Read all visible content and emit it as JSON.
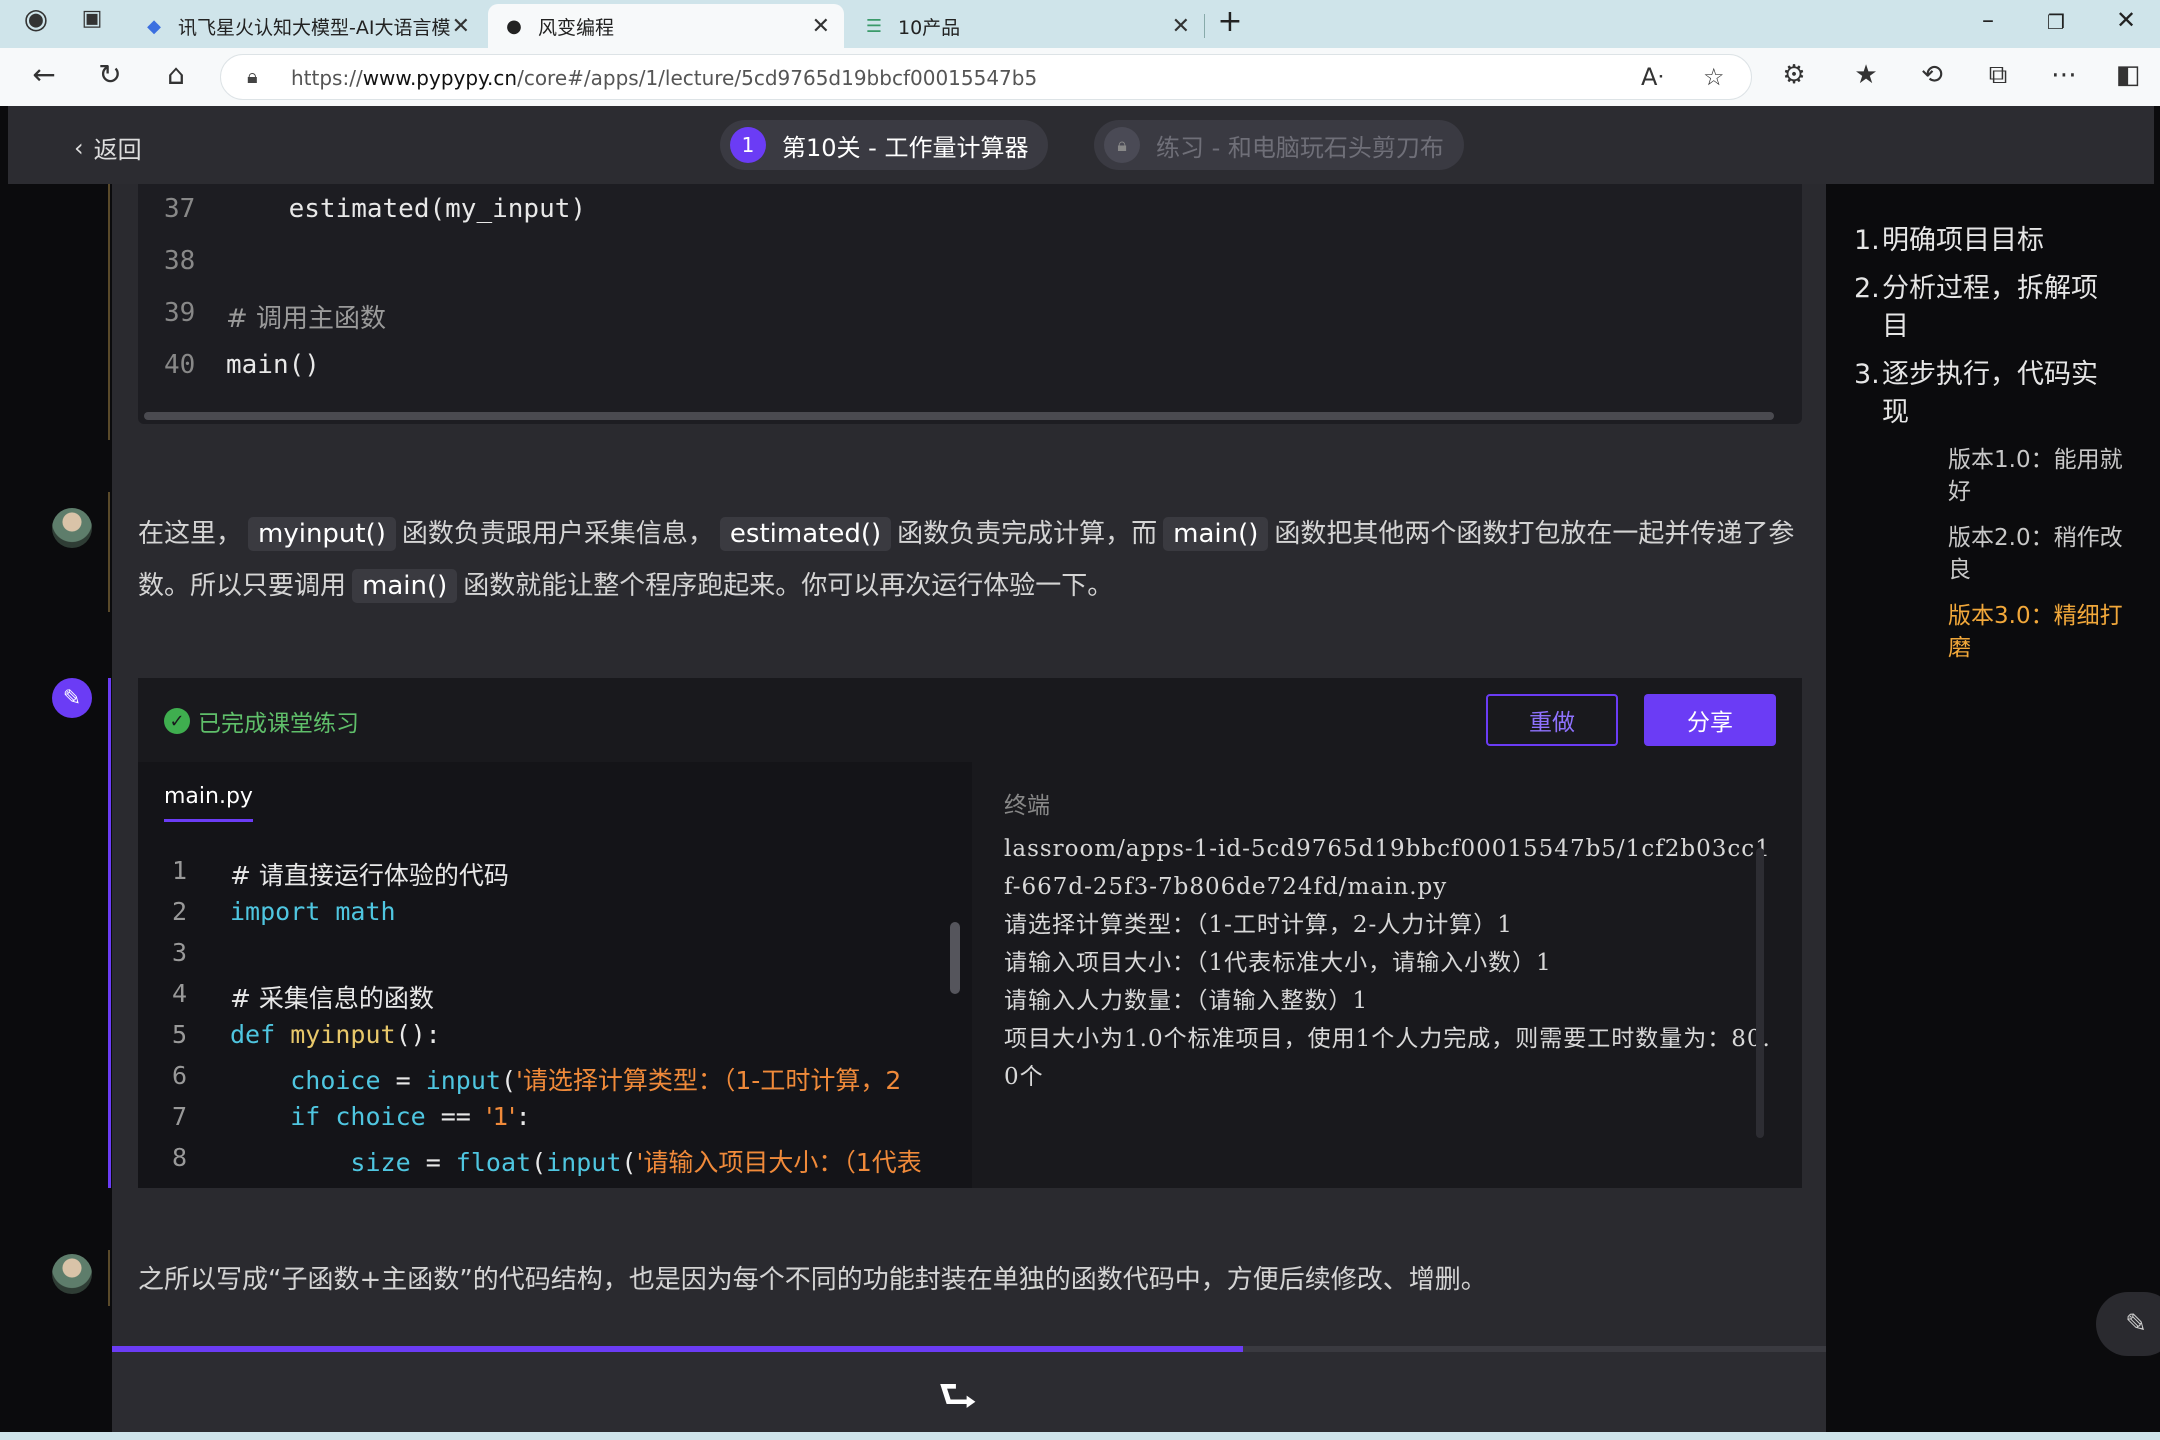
{
  "browser": {
    "tabs": [
      {
        "title": "讯飞星火认知大模型-AI大语言模",
        "icon": "spark-icon"
      },
      {
        "title": "风变编程",
        "icon": "panda-icon"
      },
      {
        "title": "10产品",
        "icon": "doc-icon"
      }
    ],
    "url_prefix": "https://",
    "url_domain": "www.pypypy.cn",
    "url_path": "/core#/apps/1/lecture/5cd9765d19bbcf00015547b5"
  },
  "header": {
    "back_label": "返回",
    "level_number": "1",
    "level_title": "第10关 - 工作量计算器",
    "locked_title": "练习 - 和电脑玩石头剪刀布"
  },
  "code_top": {
    "lines": [
      {
        "n": "37",
        "text": "    estimated(my_input)"
      },
      {
        "n": "38",
        "text": ""
      },
      {
        "n": "39",
        "text": "# 调用主函数"
      },
      {
        "n": "40",
        "text": "main()"
      }
    ]
  },
  "para1": {
    "t1": "在这里，",
    "c1": "myinput()",
    "t2": "函数负责跟用户采集信息，",
    "c2": "estimated()",
    "t3": "函数负责完成计算，而",
    "c3": "main()",
    "t4": "函数把其他两个函数打包放在一起并传递了参",
    "t5": "数。所以只要调用",
    "c4": "main()",
    "t6": "函数就能让整个程序跑起来。你可以再次运行体验一下。"
  },
  "exercise": {
    "status": "已完成课堂练习",
    "redo_label": "重做",
    "share_label": "分享",
    "file_tab": "main.py",
    "terminal_label": "终端",
    "terminal_output": "lassroom/apps-1-id-5cd9765d19bbcf00015547b5/1cf2b03cc1f-667d-25f3-7b806de724fd/main.py\n请选择计算类型：（1-工时计算，2-人力计算）1\n请输入项目大小：（1代表标准大小，请输入小数）1\n请输入人力数量：（请输入整数）1\n项目大小为1.0个标准项目，使用1个人力完成，则需要工时数量为：80.0个"
  },
  "editor_lines": [
    {
      "n": "1",
      "comment": "# 请直接运行体验的代码"
    },
    {
      "n": "2",
      "kw": "import",
      "rest": " math"
    },
    {
      "n": "3"
    },
    {
      "n": "4",
      "comment": "# 采集信息的函数"
    },
    {
      "n": "5",
      "kw": "def",
      "fn": " myinput",
      "rest": "():"
    },
    {
      "n": "6",
      "indent": "    ",
      "var": "choice",
      "rest": " = ",
      "fn": "input",
      "p": "(",
      "str": "'请选择计算类型：（1-工时计算，2"
    },
    {
      "n": "7",
      "indent": "    ",
      "kw": "if",
      "var": " choice",
      "rest": " == ",
      "str": "'1'",
      "p": ":"
    },
    {
      "n": "8",
      "indent": "        ",
      "var": "size",
      "rest": " = ",
      "fn": "float",
      "p": "(",
      "fn2": "input",
      "p2": "(",
      "str": "'请输入项目大小：（1代表"
    }
  ],
  "para2": "之所以写成“子函数+主函数”的代码结构，也是因为每个不同的功能封装在单独的函数代码中，方便后续修改、增删。",
  "toc": [
    {
      "n": "1.",
      "label": "明确项目目标"
    },
    {
      "n": "2.",
      "label": "分析过程，拆解项目"
    },
    {
      "n": "3.",
      "label": "逐步执行，代码实现"
    }
  ],
  "toc_sub": [
    {
      "label": "版本1.0：能用就好",
      "active": false
    },
    {
      "label": "版本2.0：稍作改良",
      "active": false
    },
    {
      "label": "版本3.0：精细打磨",
      "active": true
    }
  ],
  "progress_fraction": 0.66,
  "colors": {
    "accent": "#6b3cf5",
    "success": "#5fbf6a",
    "toc_active": "#f2a83a"
  }
}
